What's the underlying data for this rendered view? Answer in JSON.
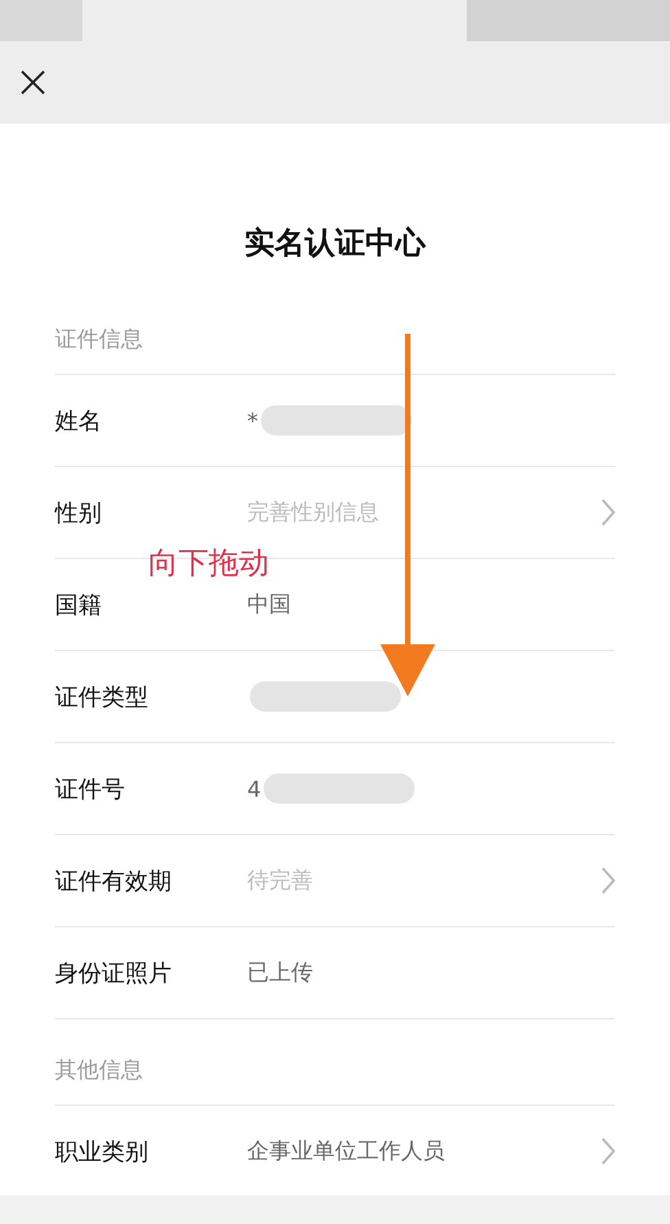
{
  "title": "实名认证中心",
  "sections": [
    {
      "title": "证件信息",
      "rows": [
        {
          "label": "姓名",
          "value": "*",
          "redacted": true
        },
        {
          "label": "性别",
          "placeholder": "完善性别信息",
          "chevron": true
        },
        {
          "label": "国籍",
          "value": "中国"
        },
        {
          "label": "证件类型",
          "redacted": true
        },
        {
          "label": "证件号",
          "value": "4",
          "redacted": true
        },
        {
          "label": "证件有效期",
          "placeholder": "待完善",
          "chevron": true
        },
        {
          "label": "身份证照片",
          "value": "已上传"
        }
      ]
    },
    {
      "title": "其他信息",
      "rows": [
        {
          "label": "职业类别",
          "value": "企事业单位工作人员",
          "chevron": true
        }
      ]
    }
  ],
  "annotation": {
    "text": "向下拖动"
  }
}
